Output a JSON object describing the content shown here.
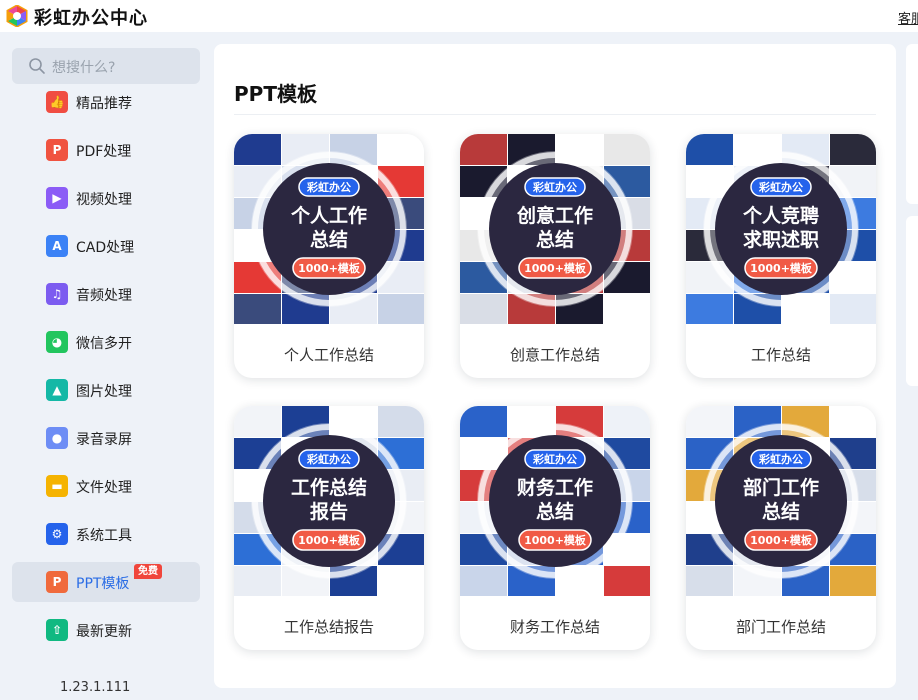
{
  "app": {
    "title": "彩虹办公中心",
    "service_link": "客服"
  },
  "search": {
    "placeholder": "想搜什么?"
  },
  "sidebar": {
    "items": [
      {
        "label": "精品推荐",
        "icon": "thumbs-up-icon",
        "color": "#f04d42",
        "glyph": "👍"
      },
      {
        "label": "PDF处理",
        "icon": "pdf-icon",
        "color": "#f05340",
        "glyph": "P"
      },
      {
        "label": "视频处理",
        "icon": "video-play-icon",
        "color": "#8b5cf6",
        "glyph": "▶"
      },
      {
        "label": "CAD处理",
        "icon": "cad-icon",
        "color": "#3b82f6",
        "glyph": "A"
      },
      {
        "label": "音频处理",
        "icon": "music-note-icon",
        "color": "#7c5cf0",
        "glyph": "♫"
      },
      {
        "label": "微信多开",
        "icon": "wechat-icon",
        "color": "#22c55e",
        "glyph": "◕"
      },
      {
        "label": "图片处理",
        "icon": "image-icon",
        "color": "#14b8a6",
        "glyph": "▲"
      },
      {
        "label": "录音录屏",
        "icon": "microphone-icon",
        "color": "#6d8df5",
        "glyph": "●"
      },
      {
        "label": "文件处理",
        "icon": "folder-icon",
        "color": "#f5b301",
        "glyph": "▬"
      },
      {
        "label": "系统工具",
        "icon": "gear-icon",
        "color": "#2563eb",
        "glyph": "⚙"
      },
      {
        "label": "PPT模板",
        "icon": "ppt-icon",
        "color": "#f06a3c",
        "glyph": "P",
        "badge": "免费",
        "active": true
      },
      {
        "label": "最新更新",
        "icon": "update-upload-icon",
        "color": "#10b981",
        "glyph": "⇧"
      }
    ],
    "version": "1.23.1.111"
  },
  "main": {
    "section_title": "PPT模板",
    "cards": [
      {
        "label": "个人工作总结",
        "brand": "彩虹办公",
        "line1": "个人工作",
        "line2": "总结",
        "count": "1000+模板"
      },
      {
        "label": "创意工作总结",
        "brand": "彩虹办公",
        "line1": "创意工作",
        "line2": "总结",
        "count": "1000+模板"
      },
      {
        "label": "工作总结",
        "brand": "彩虹办公",
        "line1": "个人竞聘",
        "line2": "求职述职",
        "count": "1000+模板"
      },
      {
        "label": "工作总结报告",
        "brand": "彩虹办公",
        "line1": "工作总结",
        "line2": "报告",
        "count": "1000+模板"
      },
      {
        "label": "财务工作总结",
        "brand": "彩虹办公",
        "line1": "财务工作",
        "line2": "总结",
        "count": "1000+模板"
      },
      {
        "label": "部门工作总结",
        "brand": "彩虹办公",
        "line1": "部门工作",
        "line2": "总结",
        "count": "1000+模板"
      }
    ]
  },
  "colors": {
    "accent": "#2b6de5",
    "badge": "#f0463c",
    "pill_blue": "#2563eb",
    "pill_red": "#f05a46",
    "circle_dark": "#2b2740"
  }
}
